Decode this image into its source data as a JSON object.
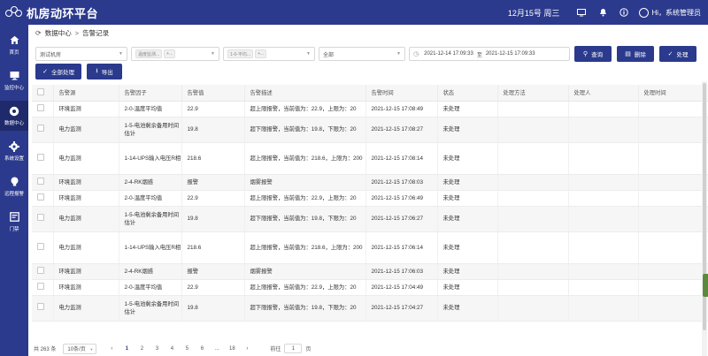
{
  "header": {
    "title": "机房动环平台",
    "date": "12月15号 周三",
    "user": "Hi，系统管理员"
  },
  "sidebar": {
    "items": [
      {
        "label": "首页",
        "icon": "home-icon"
      },
      {
        "label": "监控中心",
        "icon": "monitor-icon"
      },
      {
        "label": "数据中心",
        "icon": "data-center-icon",
        "active": true
      },
      {
        "label": "系统设置",
        "icon": "settings-icon"
      },
      {
        "label": "远程报警",
        "icon": "alarm-bulb-icon"
      },
      {
        "label": "门禁",
        "icon": "access-card-icon"
      }
    ]
  },
  "breadcrumb": {
    "parent": "数据中心",
    "separator": ">",
    "current": "告警记录"
  },
  "filters": {
    "room": "测试机房",
    "device_tag": "温度监测...",
    "device_more": "+...",
    "factor_tag": "1-0-平均...",
    "factor_more": "+...",
    "status": "全部",
    "date_start": "2021-12-14 17:09:33",
    "date_sep": "至",
    "date_end": "2021-12-15 17:09:33"
  },
  "buttons": {
    "query": "查询",
    "delete": "删除",
    "handle": "处理",
    "handle_all": "全部处理",
    "export": "导出"
  },
  "table": {
    "columns": [
      "告警源",
      "告警因子",
      "告警值",
      "告警描述",
      "告警时间",
      "状态",
      "处理方法",
      "处理人",
      "处理时间"
    ],
    "rows": [
      {
        "source": "环境监测",
        "factor": "2-0-温度平均值",
        "value": "22.9",
        "desc": "超上限报警，当前值为：22.9，上限为：20",
        "time": "2021-12-15 17:08:49",
        "status": "未处理"
      },
      {
        "source": "电力监测",
        "factor": "1-5-电池剩余备用时间估计",
        "value": "19.8",
        "desc": "超下限报警，当前值为：19.8，下限为：20",
        "time": "2021-12-15 17:08:27",
        "status": "未处理"
      },
      {
        "source": "电力监测",
        "factor": "1-14-UPS输入电压R相",
        "value": "218.6",
        "desc": "超上限报警，当前值为：218.6，上限为：200",
        "time": "2021-12-15 17:08:14",
        "status": "未处理"
      },
      {
        "source": "环境监测",
        "factor": "2-4-RK烟感",
        "value": "报警",
        "desc": "烟雾报警",
        "time": "2021-12-15 17:08:03",
        "status": "未处理"
      },
      {
        "source": "环境监测",
        "factor": "2-0-温度平均值",
        "value": "22.9",
        "desc": "超上限报警，当前值为：22.9，上限为：20",
        "time": "2021-12-15 17:06:49",
        "status": "未处理"
      },
      {
        "source": "电力监测",
        "factor": "1-5-电池剩余备用时间估计",
        "value": "19.8",
        "desc": "超下限报警，当前值为：19.8，下限为：20",
        "time": "2021-12-15 17:06:27",
        "status": "未处理"
      },
      {
        "source": "电力监测",
        "factor": "1-14-UPS输入电压R相",
        "value": "218.6",
        "desc": "超上限报警，当前值为：218.6，上限为：200",
        "time": "2021-12-15 17:06:14",
        "status": "未处理"
      },
      {
        "source": "环境监测",
        "factor": "2-4-RK烟感",
        "value": "报警",
        "desc": "烟雾报警",
        "time": "2021-12-15 17:06:03",
        "status": "未处理"
      },
      {
        "source": "环境监测",
        "factor": "2-0-温度平均值",
        "value": "22.9",
        "desc": "超上限报警，当前值为：22.9，上限为：20",
        "time": "2021-12-15 17:04:49",
        "status": "未处理"
      },
      {
        "source": "电力监测",
        "factor": "1-5-电池剩余备用时间估计",
        "value": "19.8",
        "desc": "超下限报警，当前值为：19.8，下限为：20",
        "time": "2021-12-15 17:04:27",
        "status": "未处理"
      }
    ]
  },
  "pagination": {
    "total": "共 263 条",
    "page_size": "10条/页",
    "prev": "‹",
    "pages": [
      "1",
      "2",
      "3",
      "4",
      "5",
      "6",
      "...",
      "18"
    ],
    "current": "1",
    "next": "›",
    "goto_label": "前往",
    "goto_value": "1",
    "goto_unit": "页"
  },
  "colors": {
    "primary": "#2b3a8c",
    "sidebar_active": "#1e2a6b"
  }
}
